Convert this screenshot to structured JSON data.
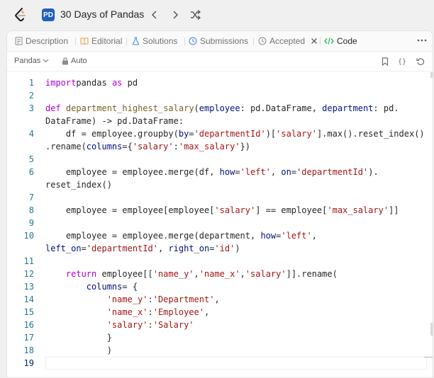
{
  "topbar": {
    "title": "30 Days of Pandas",
    "badge": "PD"
  },
  "tabs": [
    {
      "label": "Description"
    },
    {
      "label": "Editorial"
    },
    {
      "label": "Solutions"
    },
    {
      "label": "Submissions"
    },
    {
      "label": "Accepted"
    },
    {
      "label": "Code"
    }
  ],
  "toolbar": {
    "language": "Pandas",
    "mode": "Auto"
  },
  "code": {
    "line_numbers": [
      "1",
      "2",
      "3",
      "",
      "4",
      "",
      "5",
      "6",
      "",
      "7",
      "8",
      "9",
      "10",
      "",
      "11",
      "12",
      "13",
      "14",
      "15",
      "16",
      "17",
      "18",
      "19"
    ],
    "lines": [
      [
        [
          "kw",
          "import"
        ],
        [
          "",
          "pandas "
        ],
        [
          "kw",
          "as"
        ],
        [
          "",
          " pd"
        ]
      ],
      [],
      [
        [
          "kw",
          "def"
        ],
        [
          "",
          " "
        ],
        [
          "fn",
          "department_highest_salary"
        ],
        [
          "",
          "("
        ],
        [
          "pm",
          "employee"
        ],
        [
          "",
          ": pd.DataFrame, "
        ],
        [
          "pm",
          "department"
        ],
        [
          "",
          ": pd."
        ]
      ],
      [
        [
          "",
          "DataFrame) -> pd.DataFrame:"
        ]
      ],
      [
        [
          "",
          "    df = employee.groupby("
        ],
        [
          "pm",
          "by"
        ],
        [
          "",
          "="
        ],
        [
          "st",
          "'departmentId'"
        ],
        [
          "",
          ")["
        ],
        [
          "st",
          "'salary'"
        ],
        [
          "",
          "].max().reset_index()"
        ]
      ],
      [
        [
          "",
          ".rename("
        ],
        [
          "pm",
          "columns"
        ],
        [
          "",
          "={"
        ],
        [
          "st",
          "'salary'"
        ],
        [
          "",
          ":"
        ],
        [
          "st",
          "'max_salary'"
        ],
        [
          "",
          "})"
        ]
      ],
      [],
      [
        [
          "",
          "    employee = employee.merge(df, "
        ],
        [
          "pm",
          "how"
        ],
        [
          "",
          "="
        ],
        [
          "st",
          "'left'"
        ],
        [
          "",
          ", "
        ],
        [
          "pm",
          "on"
        ],
        [
          "",
          "="
        ],
        [
          "st",
          "'departmentId'"
        ],
        [
          "",
          ")."
        ]
      ],
      [
        [
          "",
          "reset_index()"
        ]
      ],
      [],
      [
        [
          "",
          "    employee = employee[employee["
        ],
        [
          "st",
          "'salary'"
        ],
        [
          "",
          "] == employee["
        ],
        [
          "st",
          "'max_salary'"
        ],
        [
          "",
          "]]"
        ]
      ],
      [],
      [
        [
          "",
          "    employee = employee.merge(department, "
        ],
        [
          "pm",
          "how"
        ],
        [
          "",
          "="
        ],
        [
          "st",
          "'left'"
        ],
        [
          "",
          ","
        ]
      ],
      [
        [
          "pm",
          "left_on"
        ],
        [
          "",
          "="
        ],
        [
          "st",
          "'departmentId'"
        ],
        [
          "",
          ", "
        ],
        [
          "pm",
          "right_on"
        ],
        [
          "",
          "="
        ],
        [
          "st",
          "'id'"
        ],
        [
          "",
          ")"
        ]
      ],
      [],
      [
        [
          "kw",
          "    return"
        ],
        [
          "",
          " employee[["
        ],
        [
          "st",
          "'name_y'"
        ],
        [
          "",
          ","
        ],
        [
          "st",
          "'name_x'"
        ],
        [
          "",
          ","
        ],
        [
          "st",
          "'salary'"
        ],
        [
          "",
          "]].rename("
        ]
      ],
      [
        [
          "",
          "        "
        ],
        [
          "pm",
          "columns"
        ],
        [
          "",
          "= {"
        ]
      ],
      [
        [
          "",
          "            "
        ],
        [
          "st",
          "'name_y'"
        ],
        [
          "",
          ":"
        ],
        [
          "st",
          "'Department'"
        ],
        [
          "",
          ","
        ]
      ],
      [
        [
          "",
          "            "
        ],
        [
          "st",
          "'name_x'"
        ],
        [
          "",
          ":"
        ],
        [
          "st",
          "'Employee'"
        ],
        [
          "",
          ","
        ]
      ],
      [
        [
          "",
          "            "
        ],
        [
          "st",
          "'salary'"
        ],
        [
          "",
          ":"
        ],
        [
          "st",
          "'Salary'"
        ]
      ],
      [
        [
          "",
          "            }"
        ]
      ],
      [
        [
          "",
          "            )"
        ]
      ],
      []
    ]
  }
}
